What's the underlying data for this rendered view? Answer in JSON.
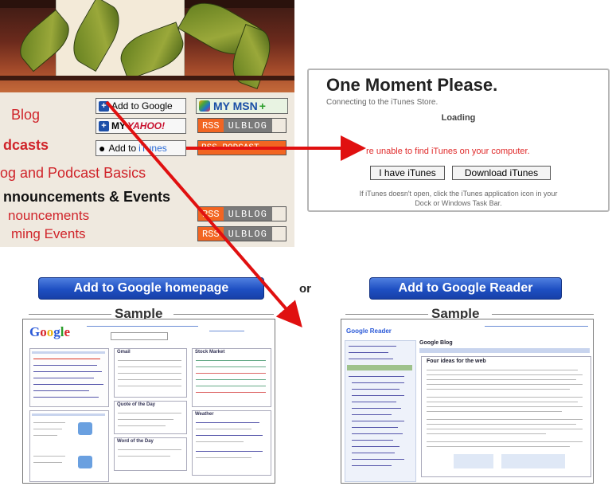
{
  "left_panel": {
    "blog": "Blog",
    "podcasts": "dcasts",
    "basics": "og and Podcast Basics",
    "announcements_heading": "nnouncements & Events",
    "announcements": "nouncements",
    "upcoming": "ming Events",
    "add_to_google": "Add to Google",
    "my_msn": "MY MSN",
    "my_yahoo_prefix": "MY",
    "my_yahoo_brand": "YAHOO!",
    "rss": "RSS",
    "ulblog": "ULBLOG",
    "add_to_itunes_prefix": "Add to",
    "add_to_itunes_brand": "iTunes",
    "rss_podcast_partial": "RSS PODCAST"
  },
  "dialog": {
    "title": "One Moment Please.",
    "subtitle": "Connecting to the iTunes Store.",
    "loading": "Loading",
    "error": "re unable to find iTunes on your computer.",
    "btn_have": "I have iTunes",
    "btn_download": "Download iTunes",
    "help_line1": "If iTunes doesn't open, click the iTunes application icon in your",
    "help_line2": "Dock or Windows Task Bar."
  },
  "bottom": {
    "btn_homepage": "Add to Google homepage",
    "or": "or",
    "btn_reader": "Add to Google Reader",
    "sample": "Sample"
  },
  "thumb_left": {
    "logo": "Google",
    "box1_title": "Gmail",
    "box2_title": "Stock Market",
    "box3_title": "Weather",
    "box4_title": "Quote of the Day",
    "box5_title": "Word of the Day"
  },
  "thumb_right": {
    "logo": "Google Reader",
    "header": "Google Blog",
    "post_title": "Four ideas for the web"
  },
  "colors": {
    "red_text": "#d0242a",
    "arrow": "#e01010",
    "blue_button": "#1e4fc2",
    "rss_orange": "#f26522"
  }
}
